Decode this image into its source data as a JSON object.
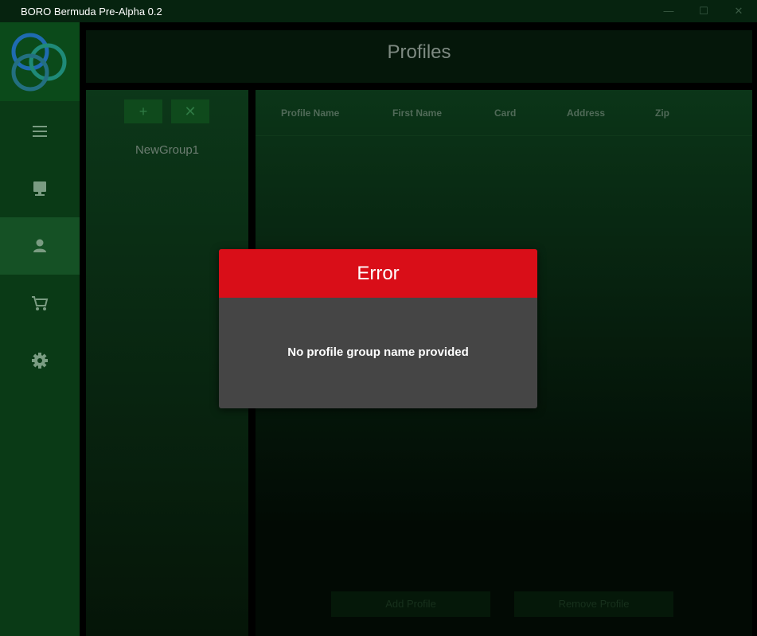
{
  "window": {
    "title": "BORO Bermuda Pre-Alpha 0.2",
    "controls": {
      "minimize": "—",
      "maximize": "☐",
      "close": "✕"
    }
  },
  "sidebar": {
    "items": [
      {
        "icon": "menu-icon"
      },
      {
        "icon": "monitor-icon"
      },
      {
        "icon": "user-icon",
        "active": true
      },
      {
        "icon": "cart-icon"
      },
      {
        "icon": "gear-icon"
      }
    ]
  },
  "header": {
    "title": "Profiles"
  },
  "groups": {
    "add_label": "+",
    "remove_label": "✕",
    "items": [
      "NewGroup1"
    ]
  },
  "table": {
    "columns": [
      "Profile Name",
      "First Name",
      "Card",
      "Address",
      "Zip"
    ],
    "rows": []
  },
  "actions": {
    "add_profile": "Add Profile",
    "remove_profile": "Remove Profile"
  },
  "dialog": {
    "title": "Error",
    "message": "No profile group name provided"
  },
  "colors": {
    "sidebar": "#0a3a16",
    "dialog_header": "#d90e18",
    "dialog_body": "#454545"
  }
}
